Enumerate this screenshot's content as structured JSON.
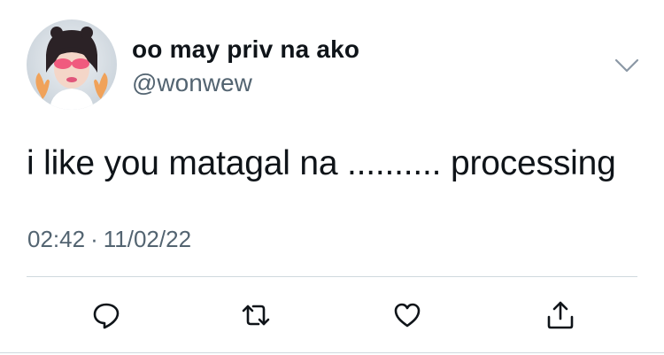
{
  "tweet": {
    "display_name": "oo may priv na ako",
    "handle": "@wonwew",
    "text": "i like you matagal na .......... processing",
    "time": "02:42",
    "separator": "·",
    "date": "11/02/22"
  },
  "icons": {
    "more": "chevron-down-icon",
    "reply": "reply-icon",
    "retweet": "retweet-icon",
    "like": "heart-icon",
    "share": "share-icon"
  },
  "colors": {
    "text_primary": "#0f1419",
    "text_secondary": "#536471",
    "divider": "#cfd9de"
  }
}
